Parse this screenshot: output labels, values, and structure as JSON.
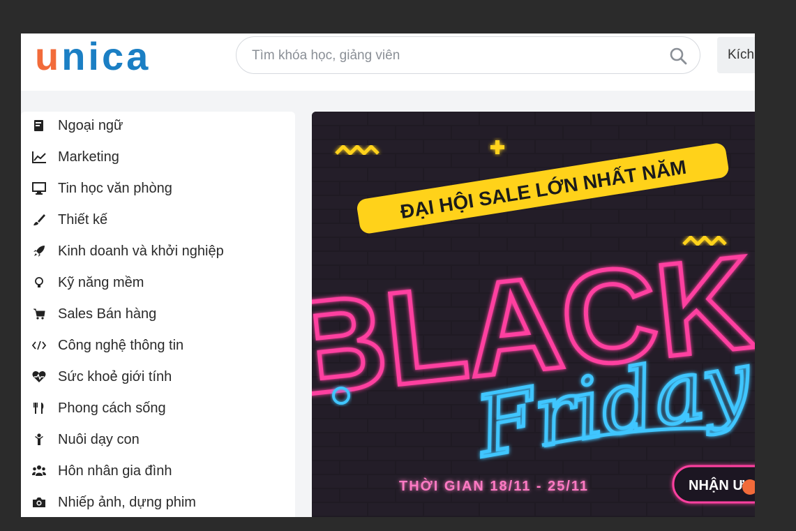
{
  "header": {
    "logo_first": "u",
    "logo_rest": "nica",
    "search_placeholder": "Tìm khóa học, giảng viên",
    "kich_label": "Kích"
  },
  "sidebar": {
    "items": [
      {
        "label": "Ngoại ngữ",
        "icon": "language-book-icon"
      },
      {
        "label": "Marketing",
        "icon": "line-chart-icon"
      },
      {
        "label": "Tin học văn phòng",
        "icon": "monitor-icon"
      },
      {
        "label": "Thiết kế",
        "icon": "paintbrush-icon"
      },
      {
        "label": "Kinh doanh và khởi nghiệp",
        "icon": "rocket-icon"
      },
      {
        "label": "Kỹ năng mềm",
        "icon": "lightbulb-icon"
      },
      {
        "label": "Sales Bán hàng",
        "icon": "cart-icon"
      },
      {
        "label": "Công nghệ thông tin",
        "icon": "code-icon"
      },
      {
        "label": "Sức khoẻ giới tính",
        "icon": "heartbeat-icon"
      },
      {
        "label": "Phong cách sống",
        "icon": "utensils-icon"
      },
      {
        "label": "Nuôi dạy con",
        "icon": "child-icon"
      },
      {
        "label": "Hôn nhân gia đình",
        "icon": "users-icon"
      },
      {
        "label": "Nhiếp ảnh, dựng phim",
        "icon": "camera-icon"
      }
    ]
  },
  "banner": {
    "tagline": "ĐẠI HỘI SALE LỚN NHẤT NĂM",
    "title_black": "BLACK",
    "title_friday": "Friday",
    "dates": "THỜI GIAN 18/11 - 25/11",
    "cta": "NHẬN Ư"
  },
  "colors": {
    "logo_orange": "#f26b3a",
    "logo_blue": "#1b7fc4",
    "neon_pink": "#ff3fa0",
    "neon_blue": "#3fc6ff",
    "neon_yellow": "#ffd21a"
  }
}
